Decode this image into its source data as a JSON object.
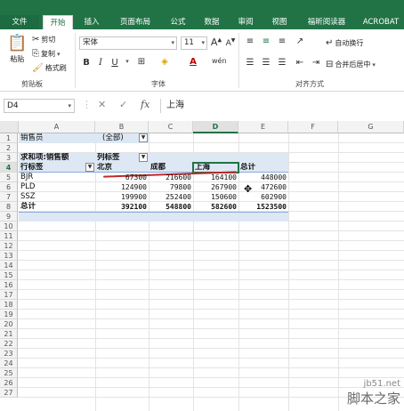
{
  "ribbon": {
    "tabs": [
      {
        "label": "文件"
      },
      {
        "label": "开始"
      },
      {
        "label": "插入"
      },
      {
        "label": "页面布局"
      },
      {
        "label": "公式"
      },
      {
        "label": "数据"
      },
      {
        "label": "审阅"
      },
      {
        "label": "视图"
      },
      {
        "label": "福昕阅读器"
      },
      {
        "label": "ACROBAT"
      }
    ],
    "clipboard": {
      "paste": "粘贴",
      "cut": "剪切",
      "copy": "复制",
      "format_painter": "格式刷",
      "group": "剪贴板"
    },
    "font": {
      "name": "宋体",
      "size": "11",
      "group": "字体"
    },
    "alignment": {
      "wrap": "自动换行",
      "merge": "合并后居中",
      "group": "对齐方式"
    }
  },
  "formula_bar": {
    "name_box": "D4",
    "content": "上海"
  },
  "grid": {
    "columns": [
      "A",
      "B",
      "C",
      "D",
      "E",
      "F",
      "G"
    ],
    "rows": [
      "1",
      "2",
      "3",
      "4",
      "5",
      "6",
      "7",
      "8",
      "9",
      "10",
      "11",
      "12",
      "13",
      "14",
      "15",
      "16",
      "17",
      "18",
      "19",
      "20",
      "21",
      "22",
      "23",
      "24",
      "25",
      "26",
      "27"
    ],
    "selected_cell": "D4",
    "pivot": {
      "filter_label": "销售员",
      "filter_value": "(全部)",
      "value_caption": "求和项:销售额",
      "col_labels": "列标签",
      "row_labels": "行标签",
      "col_headers": [
        "北京",
        "成都",
        "上海",
        "总计"
      ],
      "data_rows": [
        {
          "label": "BJR",
          "values": [
            "67300",
            "216600",
            "164100",
            "448000"
          ]
        },
        {
          "label": "PLD",
          "values": [
            "124900",
            "79800",
            "267900",
            "472600"
          ]
        },
        {
          "label": "SSZ",
          "values": [
            "199900",
            "252400",
            "150600",
            "602900"
          ]
        }
      ],
      "total": {
        "label": "总计",
        "values": [
          "392100",
          "548800",
          "582600",
          "1523500"
        ]
      }
    }
  },
  "watermark": {
    "url": "jb51.net",
    "name": "脚本之家"
  }
}
